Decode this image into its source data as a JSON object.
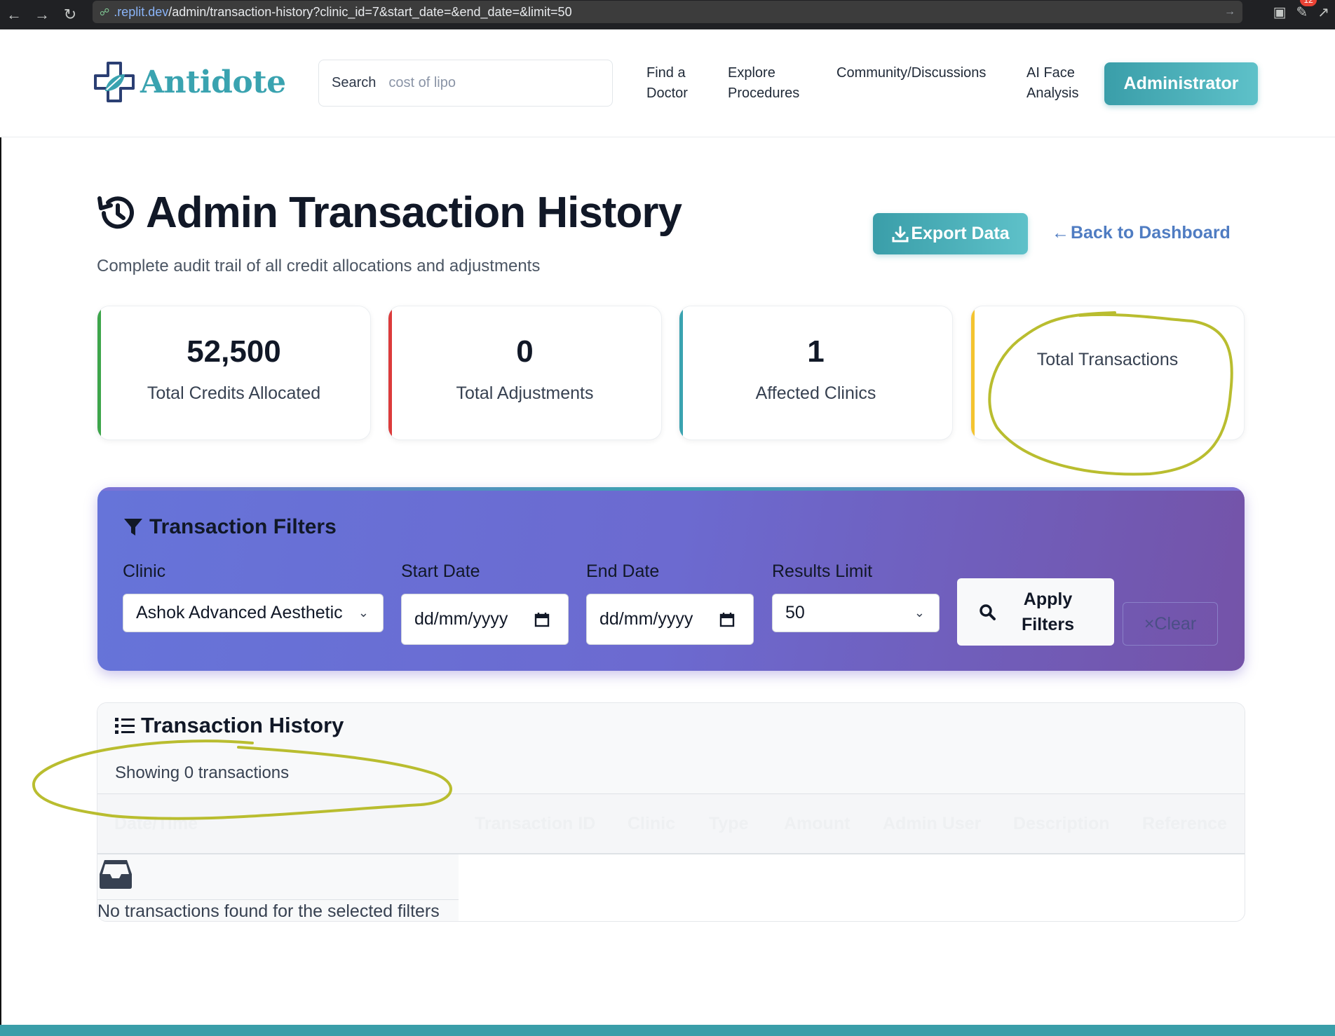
{
  "browser": {
    "url_host": ".replit.dev",
    "url_path": "/admin/transaction-history?clinic_id=7&start_date=&end_date=&limit=50",
    "notification_count": "12"
  },
  "header": {
    "logo_text": "Antidote",
    "search_label": "Search",
    "search_placeholder": "cost of lipo",
    "nav": {
      "find_doctor_line1": "Find a",
      "find_doctor_line2": "Doctor",
      "explore_line1": "Explore",
      "explore_line2": "Procedures",
      "community": "Community/Discussions",
      "ai_line1": "AI Face",
      "ai_line2": "Analysis"
    },
    "admin_button": "Administrator"
  },
  "page": {
    "title": "Admin Transaction History",
    "subtitle": "Complete audit trail of all credit allocations and adjustments",
    "export_button": "Export Data",
    "back_link": "Back to Dashboard"
  },
  "stats": [
    {
      "value": "52,500",
      "label": "Total Credits Allocated",
      "accent": "#3da54a"
    },
    {
      "value": "0",
      "label": "Total Adjustments",
      "accent": "#dc3b3b"
    },
    {
      "value": "1",
      "label": "Affected Clinics",
      "accent": "#3aa3b0"
    },
    {
      "value": "",
      "label": "Total Transactions",
      "accent": "#f4c430"
    }
  ],
  "filters": {
    "title": "Transaction Filters",
    "clinic_label": "Clinic",
    "clinic_value": "Ashok Advanced Aesthetic",
    "start_label": "Start Date",
    "start_placeholder": "dd/mm/yyyy",
    "end_label": "End Date",
    "end_placeholder": "dd/mm/yyyy",
    "limit_label": "Results Limit",
    "limit_value": "50",
    "apply_line1": "Apply",
    "apply_line2": "Filters",
    "clear_button": "Clear"
  },
  "history": {
    "title": "Transaction History",
    "count_text": "Showing 0 transactions",
    "columns": [
      "Date/Time",
      "Transaction ID",
      "Clinic",
      "Type",
      "Amount",
      "Admin User",
      "Description",
      "Reference"
    ],
    "empty_text": "No transactions found for the selected filters"
  },
  "colors": {
    "brand": "#3aa3b0",
    "link": "#4f7cc2",
    "filter_gradient_start": "#6674d9",
    "filter_gradient_end": "#7453a8",
    "annotation": "#b9bd2f"
  }
}
